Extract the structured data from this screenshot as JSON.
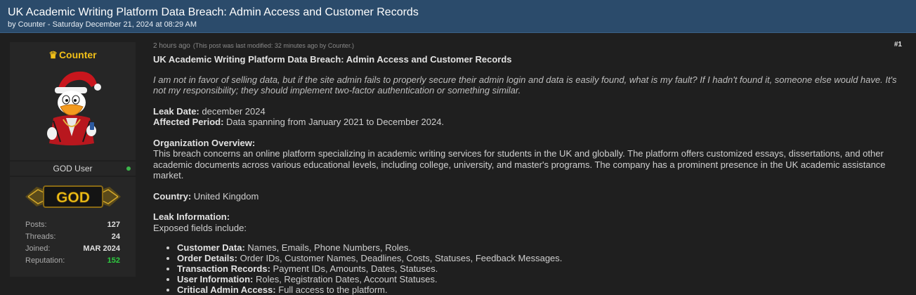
{
  "header": {
    "title": "UK Academic Writing Platform Data Breach: Admin Access and Customer Records",
    "byline": "by Counter - Saturday December 21, 2024 at 08:29 AM"
  },
  "author": {
    "username": "Counter",
    "rank": "GOD User",
    "badge_text": "GOD",
    "stats": [
      {
        "label": "Posts:",
        "value": "127"
      },
      {
        "label": "Threads:",
        "value": "24"
      },
      {
        "label": "Joined:",
        "value": "MAR 2024"
      },
      {
        "label": "Reputation:",
        "value": "152"
      }
    ],
    "colors": {
      "username": "#f2c018",
      "reputation": "#2ecc40",
      "online": "#3cb54a"
    }
  },
  "post": {
    "time_ago": "2 hours ago",
    "modified": "(This post was last modified: 32 minutes ago by Counter.)",
    "number": "#1",
    "title": "UK Academic Writing Platform Data Breach: Admin Access and Customer Records",
    "intro": "I am not in favor of selling data, but if the site admin fails to properly secure their admin login and data is easily found, what is my fault? If I hadn't found it, someone else would have. It's not my responsibility; they should implement two-factor authentication or something similar.",
    "leak_date_label": "Leak Date:",
    "leak_date_value": " december 2024",
    "affected_label": "Affected Period:",
    "affected_value": " Data spanning from January 2021 to December 2024.",
    "org_label": "Organization Overview:",
    "org_text": "This breach concerns an online platform specializing in academic writing services for students in the UK and globally. The platform offers customized essays, dissertations, and other academic documents across various educational levels, including college, university, and master's programs. The company has a prominent presence in the UK academic assistance market.",
    "country_label": "Country:",
    "country_value": " United Kingdom",
    "leak_info_label": "Leak Information:",
    "leak_info_text": "Exposed fields include:",
    "fields": [
      {
        "label": "Customer Data:",
        "value": " Names, Emails, Phone Numbers, Roles."
      },
      {
        "label": "Order Details:",
        "value": " Order IDs, Customer Names, Deadlines, Costs, Statuses, Feedback Messages."
      },
      {
        "label": "Transaction Records:",
        "value": " Payment IDs, Amounts, Dates, Statuses."
      },
      {
        "label": "User Information:",
        "value": " Roles, Registration Dates, Account Statuses."
      },
      {
        "label": "Critical Admin Access:",
        "value": " Full access to the platform."
      }
    ]
  }
}
